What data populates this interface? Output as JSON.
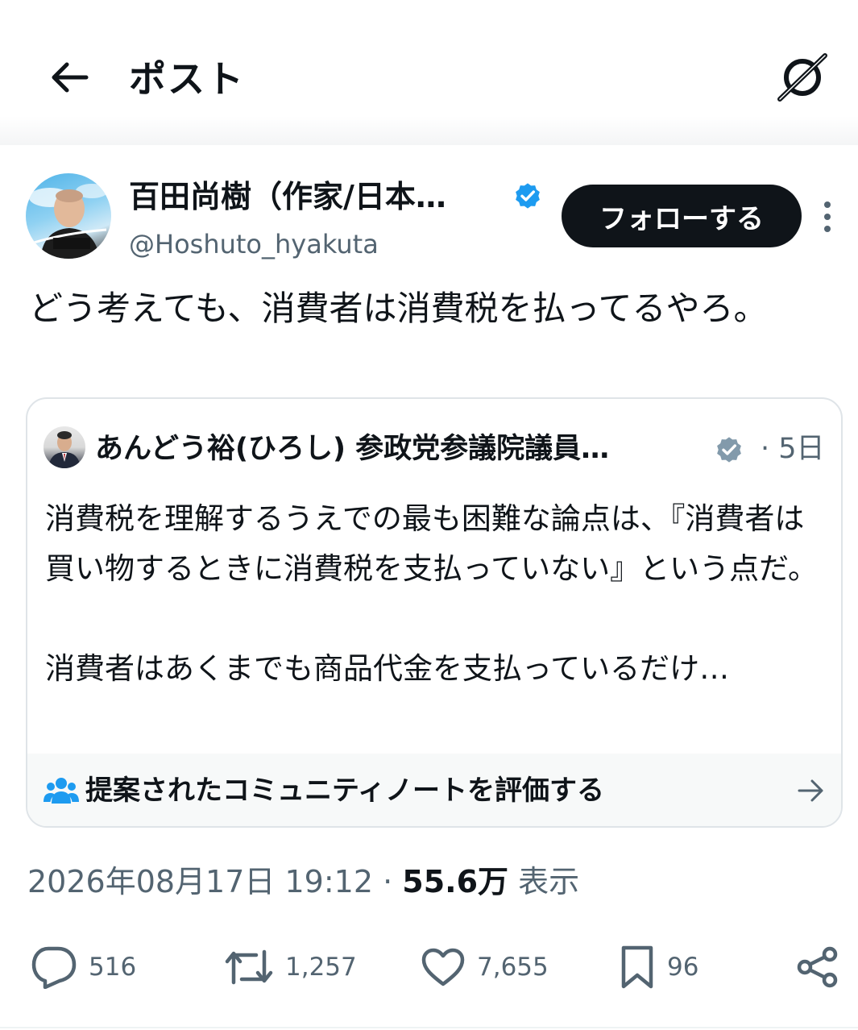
{
  "header": {
    "title": "ポスト",
    "back_icon": "arrow-left-icon",
    "grok_icon": "grok-icon"
  },
  "author": {
    "name": "百田尚樹（作家/日本…",
    "handle": "@Hoshuto_hyakuta",
    "verified": true,
    "follow_label": "フォローする"
  },
  "post": {
    "text": "どう考えても、消費者は消費税を払ってるやろ。"
  },
  "quote": {
    "author_name": "あんどう裕(ひろし) 参政党参議院議員…",
    "time": "· 5日",
    "paragraphs": [
      "消費税を理解するうえでの最も困難な論点は、『消費者は買い物するときに消費税を支払っていない』という点だ。",
      "消費者はあくまでも商品代金を支払っているだけ…"
    ],
    "community_note_label": "提案されたコミュニティノートを評価する"
  },
  "meta": {
    "timestamp": "2026年08月17日 19:12",
    "separator": "·",
    "views_count": "55.6万",
    "views_label": "表示"
  },
  "actions": {
    "replies": "516",
    "reposts": "1,257",
    "likes": "7,655",
    "bookmarks": "96"
  },
  "colors": {
    "text_primary": "#0f1419",
    "text_secondary": "#536471",
    "verified_blue": "#1d9bf0",
    "verified_gray": "#829aab",
    "border": "#dfe4e8",
    "community_icon": "#1d9bf0"
  }
}
